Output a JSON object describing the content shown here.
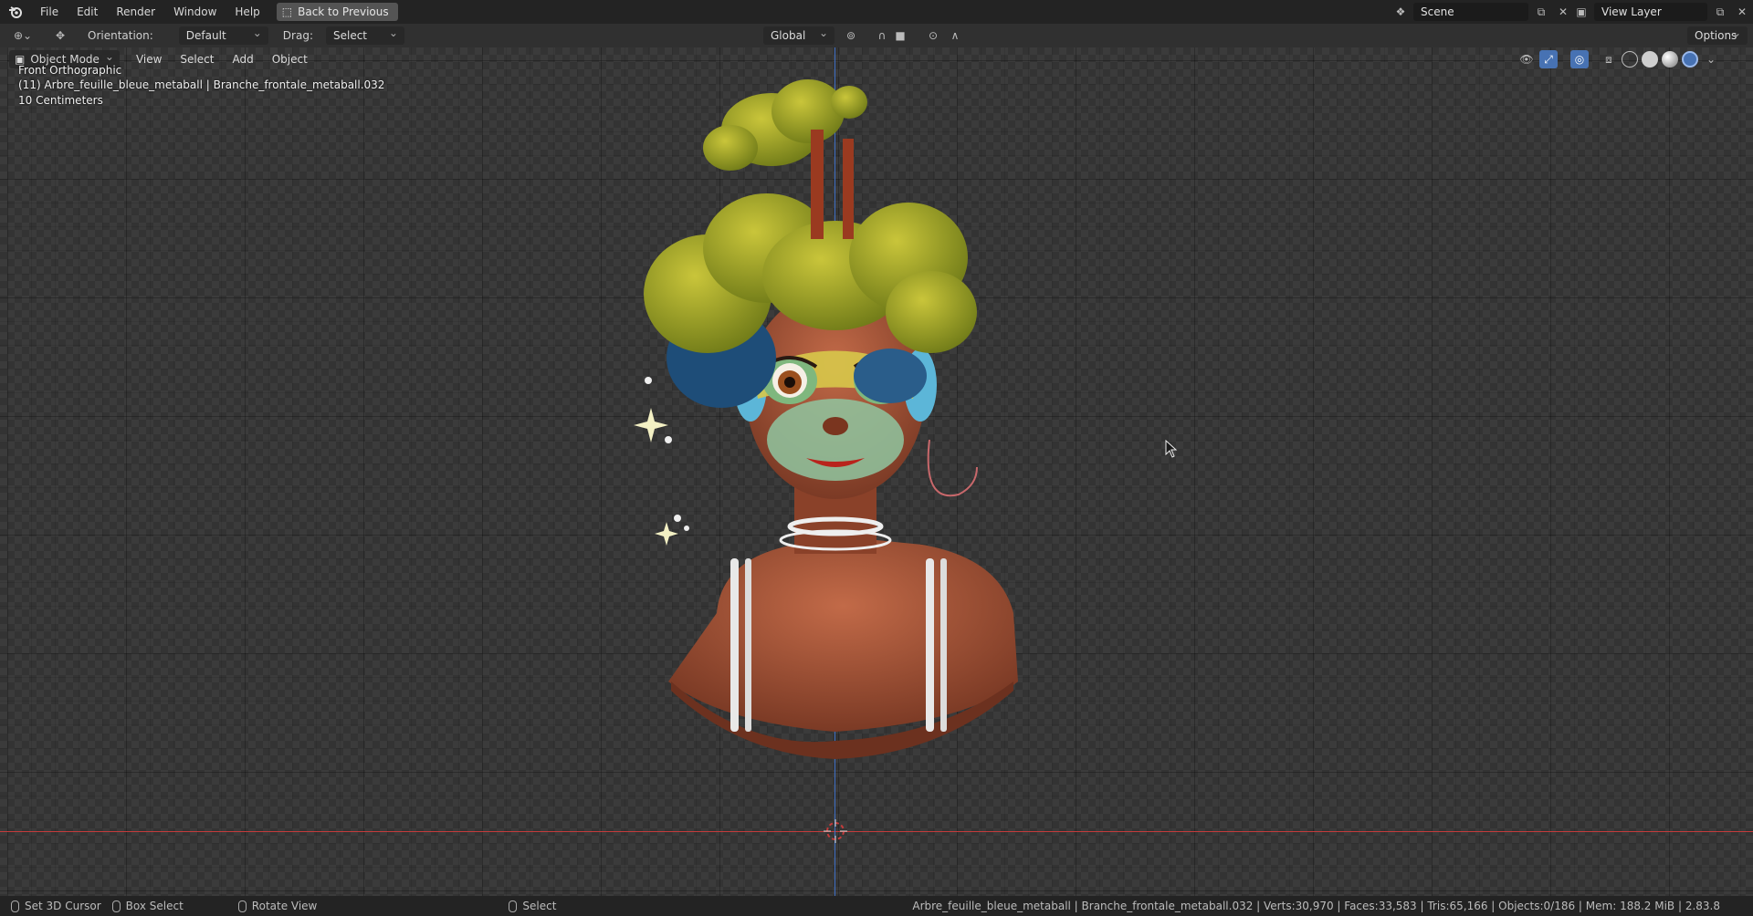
{
  "topbar": {
    "menus": [
      "File",
      "Edit",
      "Render",
      "Window",
      "Help"
    ],
    "back_button": "Back to Previous",
    "scene": "Scene",
    "view_layer": "View Layer"
  },
  "toolbar": {
    "orientation_label": "Orientation:",
    "orientation_value": "Default",
    "drag_label": "Drag:",
    "drag_value": "Select Box",
    "transform_orientation": "Global",
    "options_label": "Options"
  },
  "viewport": {
    "mode": "Object Mode",
    "menus": [
      "View",
      "Select",
      "Add",
      "Object"
    ],
    "view_name": "Front Orthographic",
    "active_object": "(11) Arbre_feuille_bleue_metaball | Branche_frontale_metaball.032",
    "scale": "10 Centimeters"
  },
  "statusbar": {
    "left_items": [
      "Set 3D Cursor",
      "Box Select",
      "Rotate View",
      "Select"
    ],
    "stats": "Arbre_feuille_bleue_metaball | Branche_frontale_metaball.032 | Verts:30,970 | Faces:33,583 | Tris:65,166 | Objects:0/186 | Mem: 188.2 MiB | 2.83.8"
  },
  "colors": {
    "axis_x": "#c43b3b",
    "axis_z": "#3d6ec4",
    "active_blue": "#4772b3"
  }
}
